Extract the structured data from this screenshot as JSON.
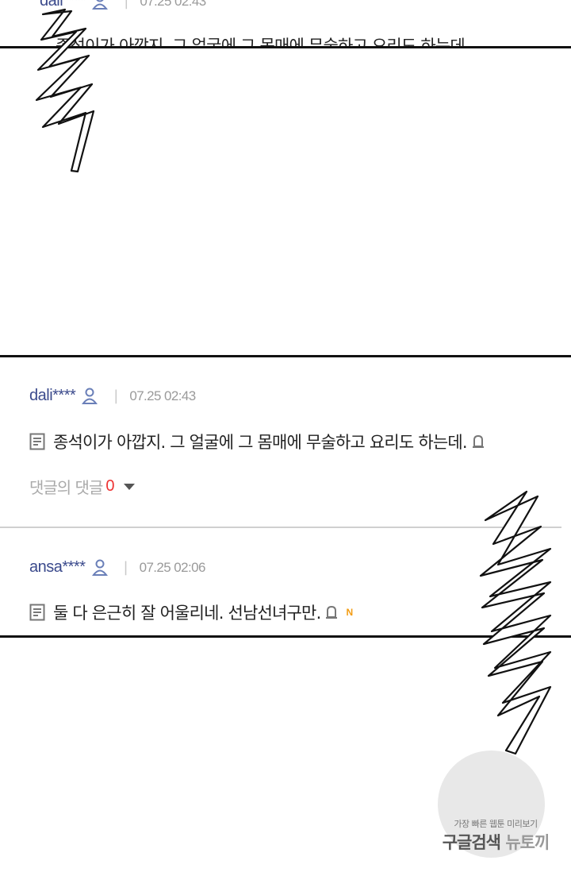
{
  "top_comment": {
    "user": "dali****",
    "date": "07.25 02:43",
    "text": "종석이가 아깝지. 그 얼굴에 그 몸매에 무술하고 요리도 하는데."
  },
  "comments": [
    {
      "user": "dali****",
      "date": "07.25 02:43",
      "text": "종석이가 아깝지. 그 얼굴에 그 몸매에 무술하고 요리도 하는데.",
      "replies_label": "댓글의 댓글",
      "replies_count": "0"
    },
    {
      "user": "ansa****",
      "date": "07.25 02:06",
      "text": "둘 다 은근히 잘 어울리네. 선남선녀구만.",
      "badge": "N"
    }
  ],
  "watermark": {
    "small": "가장 빠른 웹툰 미리보기",
    "big_a": "구글검색",
    "big_b": "뉴토끼"
  },
  "colors": {
    "username": "#3b4a8c",
    "date": "#9a9a9a",
    "reply_count": "#ee3333",
    "new_badge": "#f39c12",
    "panel_border": "#111111"
  }
}
